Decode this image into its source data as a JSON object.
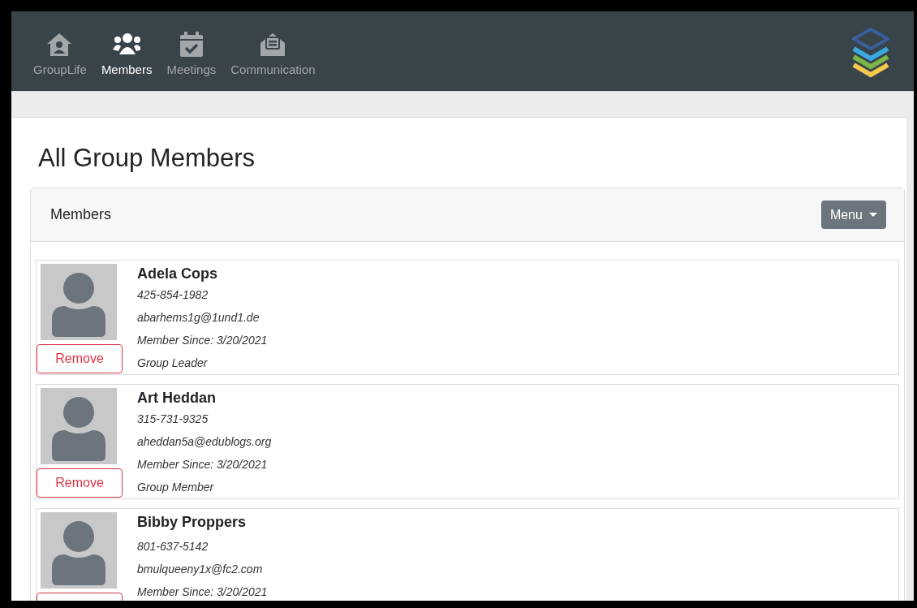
{
  "nav": {
    "items": [
      {
        "label": "GroupLife",
        "selected": false
      },
      {
        "label": "Members",
        "selected": true
      },
      {
        "label": "Meetings",
        "selected": false
      },
      {
        "label": "Communication",
        "selected": false
      }
    ]
  },
  "page": {
    "title": "All Group Members"
  },
  "panel": {
    "title": "Members",
    "menu_button": "Menu"
  },
  "members": [
    {
      "name": "Adela Cops",
      "phone": "425-854-1982",
      "email": "abarhems1g@1und1.de",
      "since": "Member Since: 3/20/2021",
      "role": "Group Leader",
      "remove": "Remove"
    },
    {
      "name": "Art Heddan",
      "phone": "315-731-9325",
      "email": "aheddan5a@edublogs.org",
      "since": "Member Since: 3/20/2021",
      "role": "Group Member",
      "remove": "Remove"
    },
    {
      "name": "Bibby Proppers",
      "phone": "801-637-5142",
      "email": "bmulqueeny1x@fc2.com",
      "since": "Member Since: 3/20/2021"
    }
  ]
}
